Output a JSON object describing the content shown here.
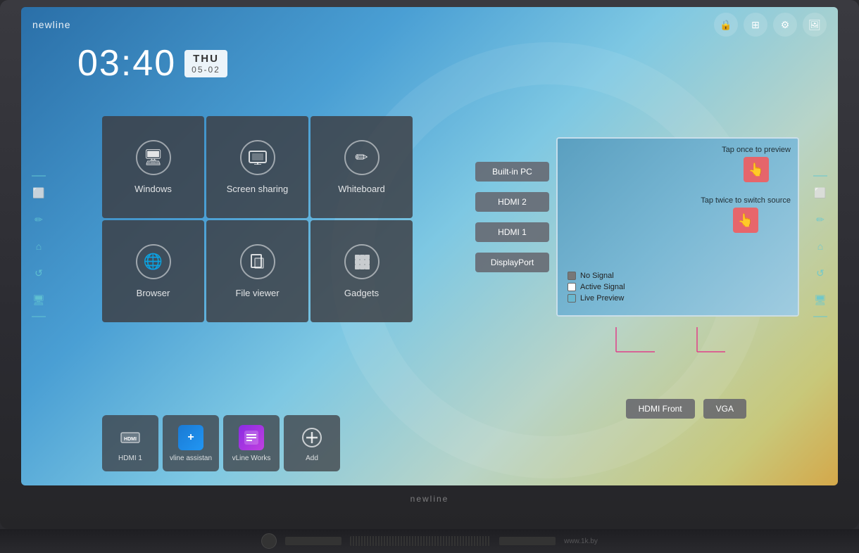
{
  "brand": {
    "name": "newline",
    "watermark": "www.1k.by"
  },
  "clock": {
    "time": "03:40",
    "day": "THU",
    "date": "05-02"
  },
  "top_icons": [
    {
      "name": "lock-icon",
      "symbol": "🔒"
    },
    {
      "name": "display-icon",
      "symbol": "🖥"
    },
    {
      "name": "settings-icon",
      "symbol": "⚙"
    },
    {
      "name": "image-icon",
      "symbol": "🖼"
    }
  ],
  "app_tiles": [
    {
      "id": "windows",
      "label": "Windows",
      "icon": "🖥"
    },
    {
      "id": "screen-sharing",
      "label": "Screen sharing",
      "icon": "📺"
    },
    {
      "id": "whiteboard",
      "label": "Whiteboard",
      "icon": "✏"
    },
    {
      "id": "browser",
      "label": "Browser",
      "icon": "🌐"
    },
    {
      "id": "file-viewer",
      "label": "File viewer",
      "icon": "📁"
    },
    {
      "id": "gadgets",
      "label": "Gadgets",
      "icon": "⊞"
    }
  ],
  "quick_launch": [
    {
      "id": "hdmi1-quick",
      "label": "HDMI 1",
      "icon": "HDMI"
    },
    {
      "id": "vline-assistant",
      "label": "vline assistan",
      "icon": "vA"
    },
    {
      "id": "vline-works",
      "label": "vLine Works",
      "icon": "vW"
    },
    {
      "id": "add",
      "label": "Add",
      "icon": "+"
    }
  ],
  "source_buttons": [
    {
      "id": "built-in-pc",
      "label": "Built-in PC"
    },
    {
      "id": "hdmi2",
      "label": "HDMI 2"
    },
    {
      "id": "hdmi1",
      "label": "HDMI 1"
    },
    {
      "id": "displayport",
      "label": "DisplayPort"
    }
  ],
  "bottom_source_buttons": [
    {
      "id": "hdmi-front",
      "label": "HDMI Front"
    },
    {
      "id": "vga",
      "label": "VGA"
    }
  ],
  "preview": {
    "hint1": "Tap once to preview",
    "hint2": "Tap twice to switch source"
  },
  "legend": [
    {
      "label": "No Signal",
      "color": "#888"
    },
    {
      "label": "Active Signal",
      "color": "#fff"
    },
    {
      "label": "Live Preview",
      "color": "#6ab"
    }
  ],
  "sidebar_left": {
    "icons": [
      {
        "name": "menu-icon",
        "symbol": "≡"
      },
      {
        "name": "screen-icon",
        "symbol": "⬜"
      },
      {
        "name": "pencil-icon",
        "symbol": "✏"
      },
      {
        "name": "home-icon",
        "symbol": "⌂"
      },
      {
        "name": "undo-icon",
        "symbol": "↺"
      },
      {
        "name": "monitor-icon",
        "symbol": "🖥"
      }
    ]
  },
  "sidebar_right": {
    "icons": [
      {
        "name": "menu-icon-r",
        "symbol": "≡"
      },
      {
        "name": "screen-icon-r",
        "symbol": "⬜"
      },
      {
        "name": "pencil-icon-r",
        "symbol": "✏"
      },
      {
        "name": "home-icon-r",
        "symbol": "⌂"
      },
      {
        "name": "undo-icon-r",
        "symbol": "↺"
      },
      {
        "name": "monitor-icon-r",
        "symbol": "🖥"
      }
    ]
  }
}
